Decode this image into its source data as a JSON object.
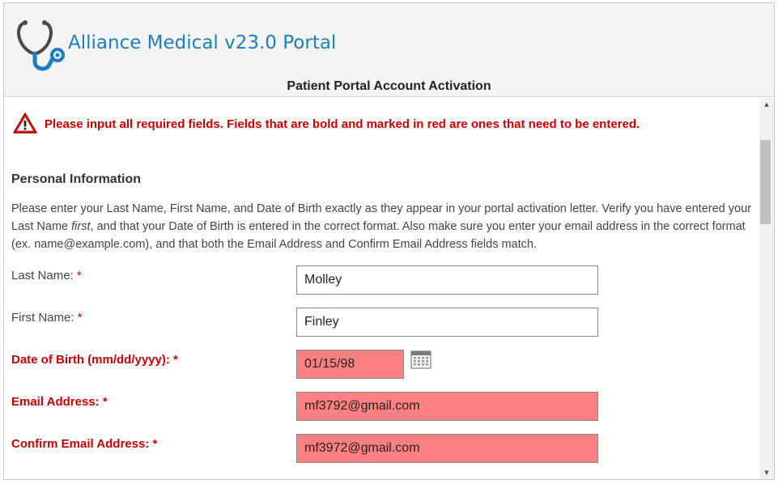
{
  "header": {
    "app_title": "Alliance Medical v23.0 Portal",
    "page_heading": "Patient Portal Account Activation",
    "logo_icon": "stethoscope-icon",
    "brand_color": "#1c7fc2"
  },
  "alert": {
    "icon": "warning-triangle-icon",
    "message": "Please input all required fields. Fields that are bold and marked in red are ones that need to be entered.",
    "color": "#cc0000"
  },
  "personal_info": {
    "section_title": "Personal Information",
    "instructions": {
      "part1": "Please enter your Last Name, First Name, and Date of Birth exactly as they appear in your portal activation letter. Verify you have entered your Last Name ",
      "emphasis": "first",
      "part2": ", and that your Date of Birth is entered in the correct format. Also make sure you enter your email address in the correct format (ex. name@example.com), and that both the Email Address and Confirm Email Address fields match."
    },
    "required_marker": "*",
    "fields": {
      "last_name": {
        "label": "Last Name:",
        "value": "Molley",
        "error": false
      },
      "first_name": {
        "label": "First Name:",
        "value": "Finley",
        "error": false
      },
      "dob": {
        "label": "Date of Birth (mm/dd/yyyy):",
        "value": "01/15/98",
        "error": true
      },
      "email": {
        "label": "Email Address:",
        "value": "mf3792@gmail.com",
        "error": true
      },
      "confirm_email": {
        "label": "Confirm Email Address:",
        "value": "mf3972@gmail.com",
        "error": true
      }
    },
    "error_fill_color": "#ff8080",
    "calendar_icon": "calendar-icon"
  }
}
